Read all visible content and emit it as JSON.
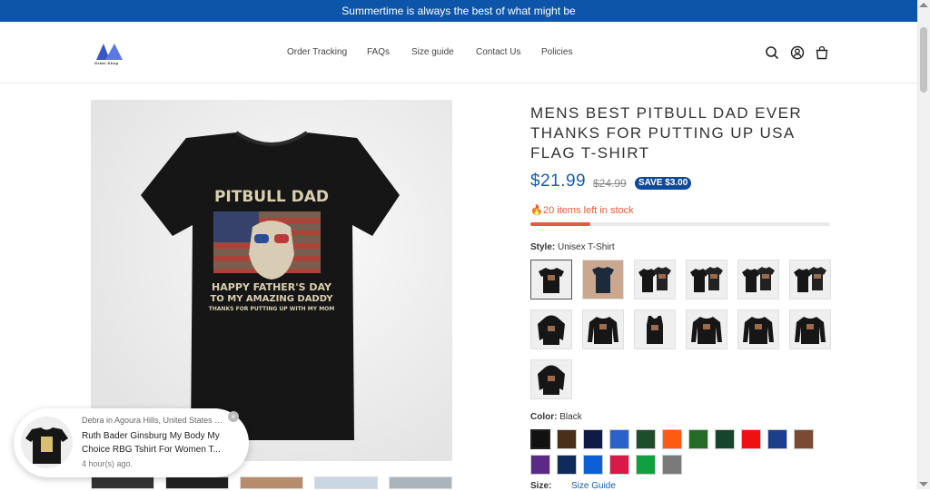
{
  "announcement": "Summertime is always the best of what might be",
  "brand": {
    "name": "Grabl Shop"
  },
  "nav": {
    "items": [
      "Order Tracking",
      "FAQs",
      "Size guide",
      "Contact Us",
      "Policies"
    ]
  },
  "product": {
    "title": "MENS BEST PITBULL DAD EVER THANKS FOR PUTTING UP USA FLAG T-SHIRT",
    "price": "$21.99",
    "old_price": "$24.99",
    "save": "SAVE $3.00",
    "stock": "20 items left in stock",
    "stock_fraction": 0.2,
    "shirt_text": {
      "line1": "PITBULL DAD",
      "line2": "HAPPY FATHER'S DAY",
      "line3": "TO MY AMAZING DADDY",
      "line4": "THANKS FOR PUTTING UP WITH MY MOM"
    }
  },
  "style": {
    "label": "Style:",
    "value": "Unisex T-Shirt",
    "options": [
      "tshirt",
      "tshirt-lifestyle",
      "tshirt-pair",
      "tshirt-pair",
      "tshirt-pair",
      "tshirt-pair",
      "hoodie",
      "longsleeve",
      "tanktop",
      "longsleeve",
      "sweatshirt",
      "sweatshirt",
      "hoodie"
    ]
  },
  "color": {
    "label": "Color:",
    "value": "Black",
    "swatches": [
      "#111111",
      "#4a2f1b",
      "#0f1b45",
      "#2a63c8",
      "#1e4d2b",
      "#ff5a12",
      "#256a25",
      "#15452a",
      "#ee1111",
      "#1c3c8c",
      "#7a4a32",
      "#5b2a86",
      "#102a5a",
      "#0d5fd6",
      "#d8194a",
      "#10a040",
      "#7a7a7a"
    ]
  },
  "size": {
    "label": "Size:",
    "guide": "Size Guide"
  },
  "popup": {
    "location": "Debra in Agoura Hills, United States p...",
    "product": "Ruth Bader Ginsburg My Body My Choice RBG Tshirt For Women T...",
    "time": "4 hour(s) ago."
  },
  "colors": {
    "accent": "#0d55a8",
    "price": "#1a5aa8",
    "stock": "#e55a3c"
  }
}
